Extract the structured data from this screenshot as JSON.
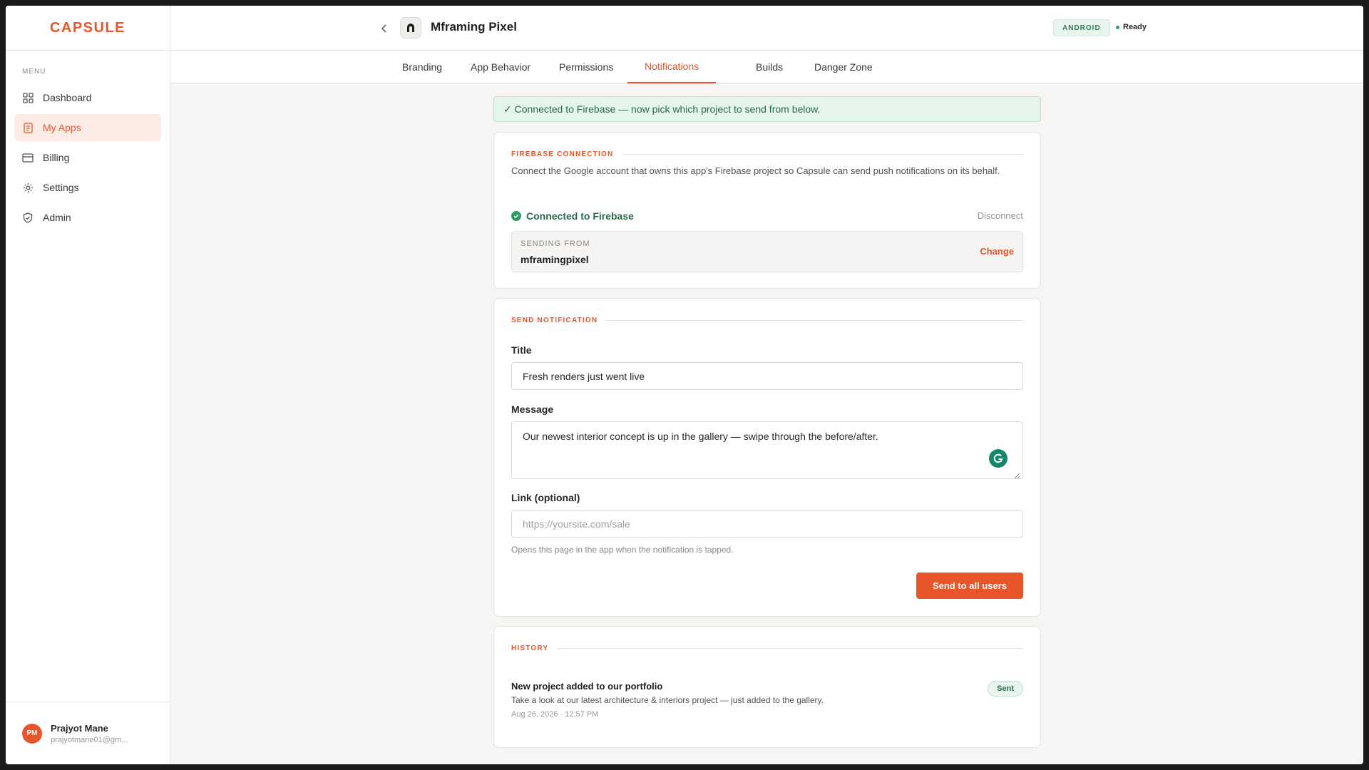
{
  "app": {
    "logo": "CAPSULE"
  },
  "sidebar": {
    "menu_label": "MENU",
    "items": [
      {
        "label": "Dashboard",
        "icon": "grid-icon"
      },
      {
        "label": "My Apps",
        "icon": "document-icon",
        "active": true
      },
      {
        "label": "Billing",
        "icon": "card-icon"
      },
      {
        "label": "Settings",
        "icon": "gear-icon"
      },
      {
        "label": "Admin",
        "icon": "shield-icon"
      }
    ],
    "user": {
      "initials": "PM",
      "name": "Prajyot Mane",
      "email": "prajyotmane01@gm..."
    }
  },
  "header": {
    "app_name": "Mframing Pixel",
    "platform": "ANDROID",
    "status": "Ready"
  },
  "tabs": [
    {
      "label": "Branding"
    },
    {
      "label": "App Behavior"
    },
    {
      "label": "Permissions"
    },
    {
      "label": "Notifications",
      "active": true
    },
    {
      "label": "Builds"
    },
    {
      "label": "Danger Zone"
    }
  ],
  "banner": {
    "text": "✓ Connected to Firebase — now pick which project to send from below."
  },
  "firebase": {
    "heading": "FIREBASE CONNECTION",
    "description": "Connect the Google account that owns this app's Firebase project so Capsule can send push notifications on its behalf.",
    "connected_text": "Connected to Firebase",
    "disconnect_label": "Disconnect",
    "sending_from_label": "SENDING FROM",
    "sending_from_value": "mframingpixel",
    "change_label": "Change"
  },
  "send": {
    "heading": "SEND NOTIFICATION",
    "title_label": "Title",
    "title_value": "Fresh renders just went live",
    "message_label": "Message",
    "message_value": "Our newest interior concept is up in the gallery — swipe through the before/after.",
    "link_label": "Link (optional)",
    "link_placeholder": "https://yoursite.com/sale",
    "link_hint": "Opens this page in the app when the notification is tapped.",
    "send_label": "Send to all users"
  },
  "history": {
    "heading": "HISTORY",
    "items": [
      {
        "title": "New project added to our portfolio",
        "body": "Take a look at our latest architecture & interiors project — just added to the gallery.",
        "time": "Aug 26, 2026 · 12:57 PM",
        "status": "Sent"
      }
    ]
  },
  "colors": {
    "accent": "#e8552a",
    "success": "#2f9e62"
  }
}
